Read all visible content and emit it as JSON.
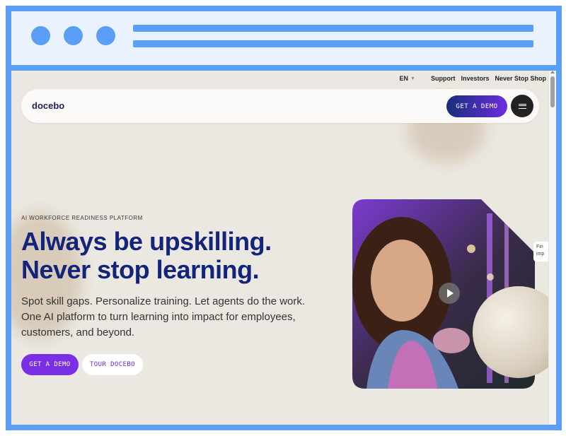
{
  "utility_nav": {
    "language": "EN",
    "links": [
      "Support",
      "Investors",
      "Never Stop Shop"
    ]
  },
  "header": {
    "logo": "docebo",
    "demo_button": "GET A DEMO",
    "menu_icon": "hamburger-menu-icon"
  },
  "hero": {
    "eyebrow": "AI WORKFORCE READINESS PLATFORM",
    "headline": [
      "Always be upskilling.",
      "Never stop learning."
    ],
    "subtext": [
      "Spot skill gaps. Personalize training. Let agents do the work.",
      "One AI platform to turn learning into impact for employees,",
      "customers, and beyond."
    ],
    "primary_cta": "GET A DEMO",
    "secondary_cta": "TOUR DOCEBO",
    "side_card_text": [
      "Fin",
      "imp"
    ],
    "play_icon": "play-icon"
  },
  "colors": {
    "frame": "#5b9ef5",
    "page_bg": "#ebe8e1",
    "headline": "#14247a",
    "accent_purple": "#7a2fe6"
  }
}
